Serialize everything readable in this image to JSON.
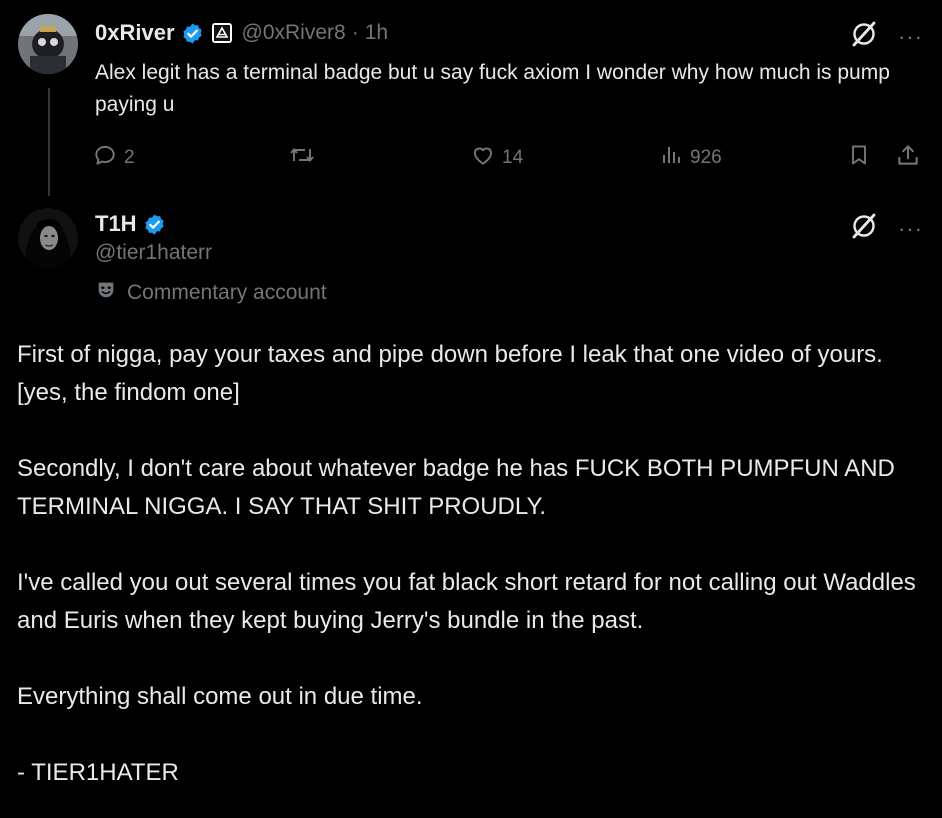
{
  "reply_tweet": {
    "author": {
      "display_name": "0xRiver",
      "handle": "@0xRiver8",
      "verified": true,
      "affiliate_badge_icon": "triangle-logo-icon",
      "avatar_icon": "avatar-image"
    },
    "separator": "·",
    "time": "1h",
    "text": "Alex legit has a  terminal badge but u say fuck axiom I wonder why how much is pump paying u",
    "stats": {
      "replies": "2",
      "retweets": "",
      "likes": "14",
      "views": "926"
    }
  },
  "main_tweet": {
    "author": {
      "display_name": "T1H",
      "handle": "@tier1haterr",
      "verified": true,
      "avatar_icon": "avatar-image"
    },
    "label": "Commentary account",
    "label_icon": "theater-mask-icon",
    "paragraphs": [
      "First of nigga, pay your taxes and pipe down before I leak that one video of yours. [yes, the findom one]",
      "Secondly, I don't care about whatever badge he has FUCK BOTH PUMPFUN AND TERMINAL NIGGA. I SAY THAT SHIT PROUDLY.",
      "I've called you out several times you fat black short retard for not calling out Waddles and Euris when they kept buying Jerry's bundle in the past.",
      "Everything shall come out in due time.",
      "- TIER1HATER"
    ]
  },
  "ui": {
    "more_label": "···",
    "grok_icon": "grok-icon",
    "colors": {
      "background": "#000000",
      "text": "#e7e9ea",
      "muted": "#71767b",
      "verified": "#1d9bf0",
      "thread_line": "#333639"
    }
  }
}
